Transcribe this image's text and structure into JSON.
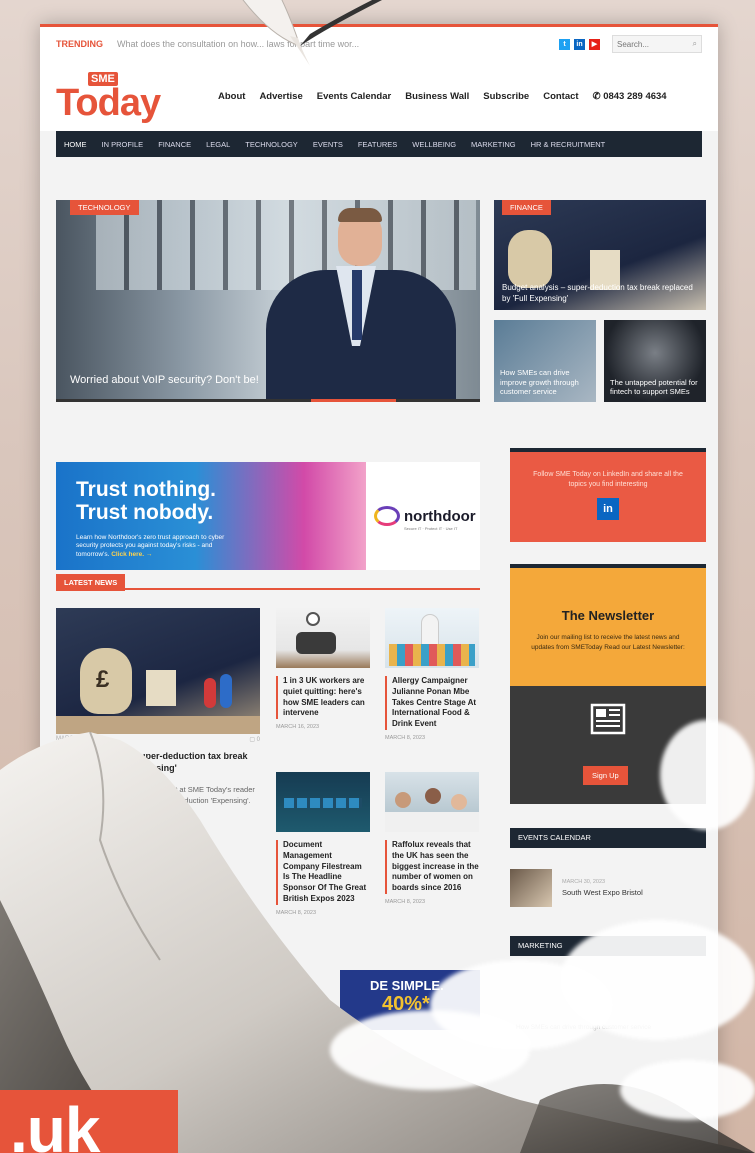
{
  "trending": {
    "label": "TRENDING",
    "text": "What does the consultation on how... laws for part time wor...",
    "search_placeholder": "Search..."
  },
  "social": [
    "tw",
    "in",
    "yt"
  ],
  "logo": {
    "badge": "SME",
    "name": "Today"
  },
  "topnav": [
    "About",
    "Advertise",
    "Events Calendar",
    "Business Wall",
    "Subscribe",
    "Contact"
  ],
  "phone": "0843 289 4634",
  "mainnav": [
    "HOME",
    "IN PROFILE",
    "FINANCE",
    "LEGAL",
    "TECHNOLOGY",
    "EVENTS",
    "FEATURES",
    "WELLBEING",
    "MARKETING",
    "HR & RECRUITMENT"
  ],
  "hero": {
    "tag": "TECHNOLOGY",
    "caption": "Worried about VoIP security? Don't be!"
  },
  "side": [
    {
      "tag": "FINANCE",
      "caption": "Budget analysis – super-deduction tax break replaced by 'Full Expensing'"
    },
    {
      "caption": "How SMEs can drive improve growth through customer service"
    },
    {
      "caption": "The untapped potential for fintech to support SMEs"
    }
  ],
  "banner": {
    "line1": "Trust nothing.",
    "line2": "Trust nobody.",
    "body": "Learn how Northdoor's zero trust approach to cyber security protects you against today's risks - and tomorrow's.",
    "cta": "Click here. →",
    "brand": "northdoor",
    "tagline": "Secure IT · Protect IT · Use IT"
  },
  "latest_news_label": "LATEST NEWS",
  "big_article": {
    "date": "MARCH 16, 2023",
    "comments": "0",
    "title": "Budget analysis – super-deduction tax break replaced by 'Full Expensing'",
    "excerpt": "In a series of Business Management at SME Today's reader with some assessment of the super-deduction 'Expensing'. On"
  },
  "articles": [
    {
      "title": "1 in 3 UK workers are quiet quitting: here's how SME leaders can intervene",
      "date": "MARCH 16, 2023"
    },
    {
      "title": "Allergy Campaigner Julianne Ponan Mbe Takes Centre Stage At International Food & Drink Event",
      "date": "MARCH 8, 2023"
    },
    {
      "title": "Document Management Company Filestream Is The Headline Sponsor Of The Great British Expos 2023",
      "date": "MARCH 8, 2023"
    },
    {
      "title": "Raffolux reveals that the UK has seen the biggest increase in the number of women on boards since 2016",
      "date": "MARCH 8, 2023"
    }
  ],
  "linkedin_box": {
    "text": "Follow SME Today on LinkedIn and share all the topics you find interesting",
    "button": "in"
  },
  "newsletter": {
    "title": "The Newsletter",
    "text": "Join our mailing list to receive the latest news and updates from SMEToday Read our Latest Newsletter:",
    "button": "Sign Up"
  },
  "events_calendar": {
    "heading": "EVENTS CALENDAR",
    "date": "MARCH 30, 2023",
    "name": "South West Expo Bristol"
  },
  "marketing_heading": "MARKETING",
  "promo": {
    "text": "DE SIMPLE.",
    "pct": "40%*"
  },
  "marketing_snippet": "How SMEs can drive through customer service",
  "corner_text": ".uk"
}
